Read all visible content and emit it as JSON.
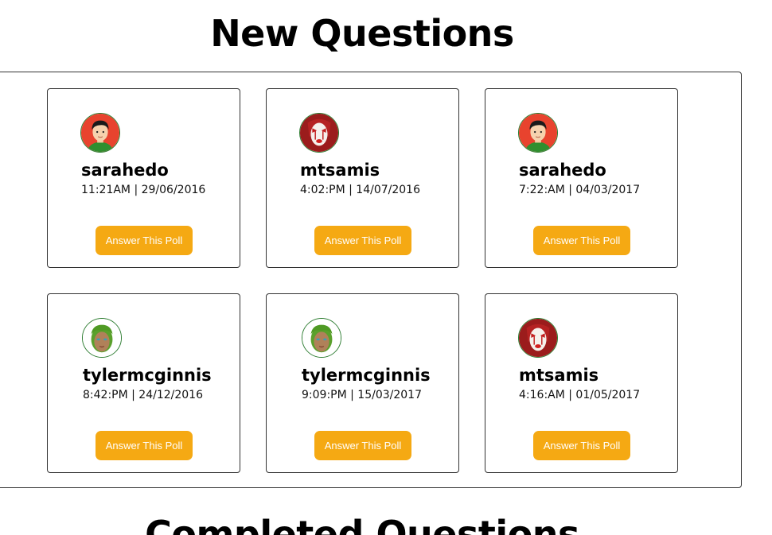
{
  "new_questions": {
    "title": "New Questions",
    "button_color": "#f5a913",
    "cards": [
      {
        "author": "sarahedo",
        "timestamp": "11:21AM | 29/06/2016",
        "button_label": "Answer This Poll",
        "avatar": "boy-avatar-icon"
      },
      {
        "author": "mtsamis",
        "timestamp": "4:02:PM | 14/07/2016",
        "button_label": "Answer This Poll",
        "avatar": "clown-avatar-icon"
      },
      {
        "author": "sarahedo",
        "timestamp": "7:22:AM | 04/03/2017",
        "button_label": "Answer This Poll",
        "avatar": "boy-avatar-icon"
      },
      {
        "author": "tylermcginnis",
        "timestamp": "8:42:PM | 24/12/2016",
        "button_label": "Answer This Poll",
        "avatar": "green-hair-avatar-icon"
      },
      {
        "author": "tylermcginnis",
        "timestamp": "9:09:PM | 15/03/2017",
        "button_label": "Answer This Poll",
        "avatar": "green-hair-avatar-icon"
      },
      {
        "author": "mtsamis",
        "timestamp": "4:16:AM | 01/05/2017",
        "button_label": "Answer This Poll",
        "avatar": "clown-avatar-icon"
      }
    ]
  },
  "completed_questions": {
    "title": "Completed Questions"
  }
}
